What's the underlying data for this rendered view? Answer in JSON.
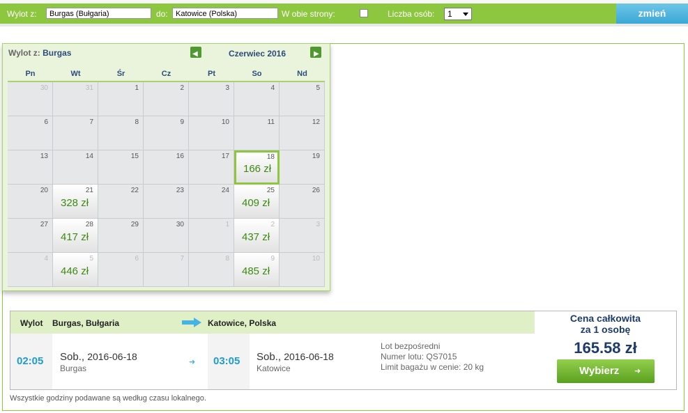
{
  "search": {
    "from_label": "Wylot z:",
    "from_value": "Burgas (Bułgaria)",
    "to_label": "do:",
    "to_value": "Katowice (Polska)",
    "roundtrip_label": "W obie strony:",
    "roundtrip_checked": false,
    "persons_label": "Liczba osób:",
    "persons_value": "1",
    "change_button": "zmień"
  },
  "calendar": {
    "from_prefix": "Wylot z:",
    "from_city": "Burgas",
    "month": "Czerwiec 2016",
    "weekdays": [
      "Pn",
      "Wt",
      "Śr",
      "Cz",
      "Pt",
      "So",
      "Nd"
    ],
    "weeks": [
      [
        {
          "d": "30",
          "dim": true
        },
        {
          "d": "31",
          "dim": true
        },
        {
          "d": "1"
        },
        {
          "d": "2"
        },
        {
          "d": "3"
        },
        {
          "d": "4"
        },
        {
          "d": "5"
        }
      ],
      [
        {
          "d": "6"
        },
        {
          "d": "7"
        },
        {
          "d": "8"
        },
        {
          "d": "9"
        },
        {
          "d": "10"
        },
        {
          "d": "11"
        },
        {
          "d": "12"
        }
      ],
      [
        {
          "d": "13"
        },
        {
          "d": "14"
        },
        {
          "d": "15"
        },
        {
          "d": "16"
        },
        {
          "d": "17"
        },
        {
          "d": "18",
          "price": "166 zł",
          "selected": true
        },
        {
          "d": "19"
        }
      ],
      [
        {
          "d": "20"
        },
        {
          "d": "21",
          "price": "328 zł"
        },
        {
          "d": "22"
        },
        {
          "d": "23"
        },
        {
          "d": "24"
        },
        {
          "d": "25",
          "price": "409 zł"
        },
        {
          "d": "26"
        }
      ],
      [
        {
          "d": "27"
        },
        {
          "d": "28",
          "price": "417 zł"
        },
        {
          "d": "29"
        },
        {
          "d": "30"
        },
        {
          "d": "1",
          "dim": true
        },
        {
          "d": "2",
          "dim": true,
          "price": "437 zł"
        },
        {
          "d": "3",
          "dim": true
        }
      ],
      [
        {
          "d": "4",
          "dim": true
        },
        {
          "d": "5",
          "dim": true,
          "price": "446 zł"
        },
        {
          "d": "6",
          "dim": true
        },
        {
          "d": "7",
          "dim": true
        },
        {
          "d": "8",
          "dim": true
        },
        {
          "d": "9",
          "dim": true,
          "price": "485 zł"
        },
        {
          "d": "10",
          "dim": true
        }
      ]
    ]
  },
  "flight": {
    "depart_label": "Wylot",
    "from_city_full": "Burgas, Bułgaria",
    "to_city_full": "Katowice, Polska",
    "depart_time": "02:05",
    "depart_day": "Sob.,",
    "depart_date": "2016-06-18",
    "depart_city": "Burgas",
    "arrive_time": "03:05",
    "arrive_day": "Sob.,",
    "arrive_date": "2016-06-18",
    "arrive_city": "Katowice",
    "info_direct": "Lot bezpośredni",
    "info_flight_no": "Numer lotu: QS7015",
    "info_baggage": "Limit bagażu w cenie: 20 kg"
  },
  "price": {
    "title_line1": "Cena całkowita",
    "title_line2": "za 1 osobę",
    "total": "165.58 zł",
    "choose_button": "Wybierz"
  },
  "footnote": "Wszystkie godziny podawane są według czasu lokalnego.",
  "colors": {
    "green": "#8dc63f",
    "blue_button": "#3aa7d6",
    "price_green": "#3d8a13",
    "time_blue": "#1e9ad6",
    "navy": "#1d3a6e"
  }
}
